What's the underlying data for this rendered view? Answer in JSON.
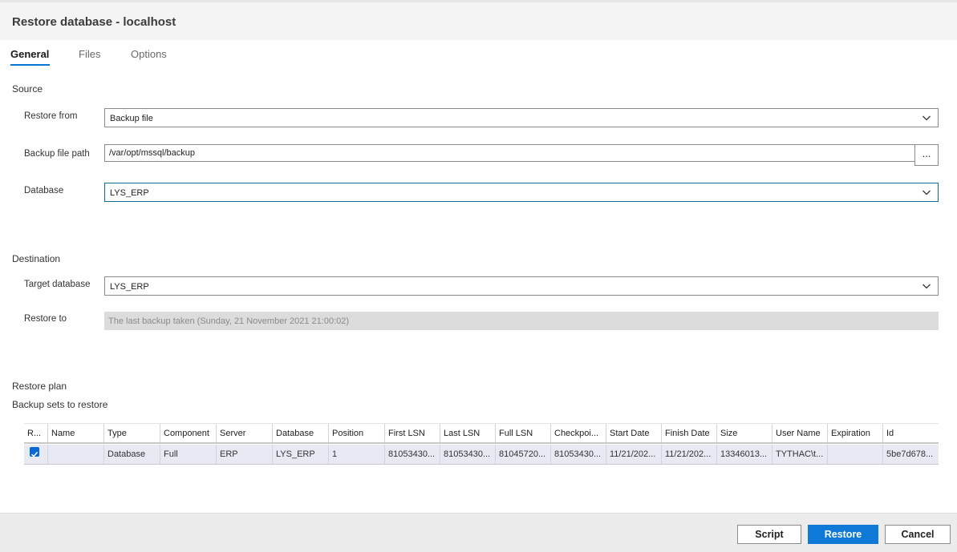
{
  "window": {
    "title": "Restore database - localhost"
  },
  "tabs": [
    {
      "label": "General",
      "active": true
    },
    {
      "label": "Files",
      "active": false
    },
    {
      "label": "Options",
      "active": false
    }
  ],
  "source": {
    "section_label": "Source",
    "restore_from": {
      "label": "Restore from",
      "value": "Backup file"
    },
    "backup_file_path": {
      "label": "Backup file path",
      "value": "/var/opt/mssql/backup",
      "browse_label": "..."
    },
    "database": {
      "label": "Database",
      "value": "LYS_ERP"
    }
  },
  "destination": {
    "section_label": "Destination",
    "target_database": {
      "label": "Target database",
      "value": "LYS_ERP"
    },
    "restore_to": {
      "label": "Restore to",
      "value": "The last backup taken (Sunday, 21 November 2021 21:00:02)"
    }
  },
  "restore_plan": {
    "section_label": "Restore plan",
    "subsection_label": "Backup sets to restore",
    "columns": [
      "R...",
      "Name",
      "Type",
      "Component",
      "Server",
      "Database",
      "Position",
      "First LSN",
      "Last LSN",
      "Full LSN",
      "Checkpoi...",
      "Start Date",
      "Finish Date",
      "Size",
      "User Name",
      "Expiration",
      "Id"
    ],
    "rows": [
      {
        "checked": true,
        "cells": [
          "",
          "",
          "Database",
          "Full",
          "ERP",
          "LYS_ERP",
          "1",
          "81053430...",
          "81053430...",
          "81045720...",
          "81053430...",
          "11/21/202...",
          "11/21/202...",
          "13346013...",
          "TYTHAC\\t...",
          "",
          "5be7d678..."
        ]
      }
    ]
  },
  "footer": {
    "script_label": "Script",
    "restore_label": "Restore",
    "cancel_label": "Cancel"
  },
  "colors": {
    "accent": "#0e79d6",
    "tab_underline": "#0078d4",
    "focus_border": "#0e6d96",
    "row_selected": "#e8eaf3"
  },
  "icons": {
    "dropdown": "chevron-down-icon",
    "checkbox": "checkmark-icon"
  }
}
